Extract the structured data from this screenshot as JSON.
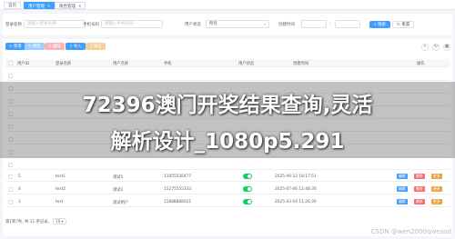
{
  "tabs": [
    {
      "label": "首页",
      "active": false
    },
    {
      "label": "用户管理",
      "active": true
    },
    {
      "label": "角色管理",
      "active": false
    }
  ],
  "search": {
    "fields": [
      {
        "label": "登录名称",
        "placeholder": "请输入登录名称",
        "value": ""
      },
      {
        "label": "手机号码",
        "placeholder": "请输入手机号码",
        "value": ""
      },
      {
        "label": "用户状态",
        "placeholder": "",
        "value": "所有"
      },
      {
        "label": "创建时间",
        "placeholder": "",
        "value": ""
      }
    ],
    "search_label": "搜索",
    "reset_label": "重置"
  },
  "toolbar": {
    "add": "新增",
    "edit": "修改",
    "delete": "删除",
    "import": "导入",
    "export": "导出"
  },
  "table": {
    "columns": [
      "用户ID",
      "登录名称",
      "用户名称",
      "手机",
      "用户状态",
      "创建时间",
      "操作"
    ],
    "rows": [
      {
        "id": "5",
        "login": "test1",
        "name": "测试1",
        "phone": "13455556477",
        "time": "2025-06-12 18:17:51"
      },
      {
        "id": "4",
        "login": "test2",
        "name": "测试2",
        "phone": "15275555333",
        "time": "2025-07-06 12:48:30"
      },
      {
        "id": "3",
        "login": "test",
        "name": "测试用户",
        "phone": "15888888021",
        "time": "2025-03-16 11:26:30"
      }
    ],
    "row_actions": {
      "edit": "编辑",
      "delete": "删除",
      "more": "更多"
    }
  },
  "overlay": {
    "line1": "72396澳门开奖结果查询,灵活",
    "line2": "解析设计_1080p5.291"
  },
  "pager": {
    "text": "第1到7条, 共 11 条记录。",
    "page_size": "10"
  },
  "watermark": "CSDN @wen2000qweasd",
  "colors": {
    "primary": "#409eff",
    "switch_on": "#13ce66",
    "danger": "#f56c6c",
    "warning": "#e6a23c"
  }
}
